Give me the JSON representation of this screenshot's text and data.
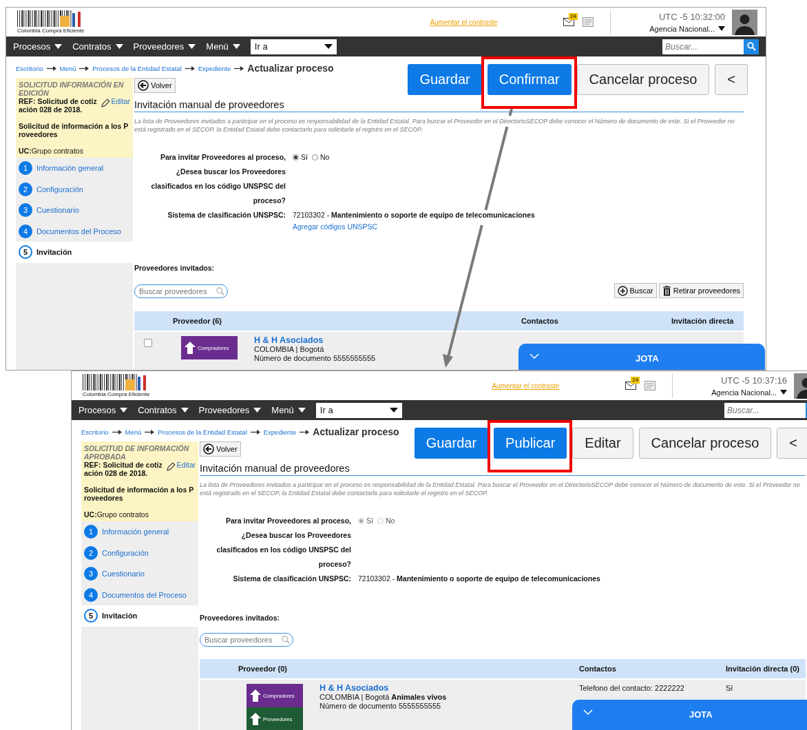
{
  "screens": [
    {
      "header": {
        "logo_text": "Colombia Compra Eficiente",
        "contrast_link": "Aumentar el contraste",
        "mail_count": "24",
        "timezone": "UTC -5",
        "time": "10:32:00",
        "agency": "Agencia Nacional..."
      },
      "nav": {
        "items": [
          "Procesos",
          "Contratos",
          "Proveedores",
          "Menú"
        ],
        "goto": "Ir a",
        "search_placeholder": "Buscar..."
      },
      "breadcrumb": {
        "links": [
          "Escritorio",
          "Menú",
          "Procesos de la Entidad Estatal",
          "Expediente"
        ],
        "current": "Actualizar proceso"
      },
      "actions": [
        {
          "label": "Guardar",
          "kind": "primary",
          "highlighted": false
        },
        {
          "label": "Confirmar",
          "kind": "primary",
          "highlighted": true
        },
        {
          "label": "Cancelar proceso",
          "kind": "secondary",
          "highlighted": false
        },
        {
          "label": "<",
          "kind": "secondary",
          "highlighted": false
        }
      ],
      "summary": {
        "status": "SOLICITUD INFORMACIÓN EN EDICIÓN",
        "reference": "REF: Solicitud de cotización 028 de 2018.",
        "edit": "Editar",
        "description": "Solicitud de información a los Proveedores",
        "unit_label": "UC:",
        "unit": "Grupo contratos"
      },
      "steps": [
        {
          "number": "1",
          "label": "Información general",
          "selected": false
        },
        {
          "number": "2",
          "label": "Configuración",
          "selected": false
        },
        {
          "number": "3",
          "label": "Cuestionario",
          "selected": false
        },
        {
          "number": "4",
          "label": "Documentos del Proceso",
          "selected": false
        },
        {
          "number": "5",
          "label": "Invitación",
          "selected": true
        }
      ],
      "back": "Volver",
      "section_title": "Invitación manual de proveedores",
      "notice": "La lista de Proveedores invitados a participar en el proceso es responsabilidad de la Entidad Estatal. Para buscar el Proveedor en el DirectorioSECOP debe conocer el Número de documento de este. Si el Proveedor no está registrado en el SECOP, la Entidad Estatal debe contactarlo para solicitarle el registro en el SECOP.",
      "invite_question": "Para invitar Proveedores al proceso, ¿Desea buscar los Proveedores clasificados en los código UNSPSC del proceso?",
      "options": [
        {
          "label": "Sí",
          "selected": true,
          "disabled": false
        },
        {
          "label": "No",
          "selected": false,
          "disabled": false
        }
      ],
      "unspsc": {
        "label": "Sistema de clasificación UNSPSC:",
        "value": "72103302 - **Mantenimiento o soporte de equipo de telecomunicaciones**",
        "add_link": "Agregar códigos UNSPSC"
      },
      "invited_label": "Proveedores invitados:",
      "supplier_search_placeholder": "Buscar proveedores",
      "tools": [
        {
          "label": "Buscar",
          "kind": "add"
        },
        {
          "label": "Retirar proveedores",
          "kind": "remove"
        }
      ],
      "table": {
        "columns": [
          "Proveedor (6)",
          "Contactos",
          "Invitación directa"
        ],
        "rows": [
          {
            "checked": false,
            "logo": [
              {
                "label": "Compradores",
                "color": "#6b2c8f"
              }
            ],
            "name": "H & H Asociados",
            "location": "COLOMBIA | Bogotá",
            "document": "Número de documento 5555555555"
          }
        ]
      },
      "chat": {
        "title": "JOTA"
      }
    },
    {
      "header": {
        "logo_text": "Colombia Compra Eficiente",
        "contrast_link": "Aumentar el contraste",
        "mail_count": "24",
        "timezone": "UTC -5",
        "time": "10:37:16",
        "agency": "Agencia Nacional..."
      },
      "nav": {
        "items": [
          "Procesos",
          "Contratos",
          "Proveedores",
          "Menú"
        ],
        "goto": "Ir a",
        "search_placeholder": "Buscar..."
      },
      "breadcrumb": {
        "links": [
          "Escritorio",
          "Menú",
          "Procesos de la Entidad Estatal",
          "Expediente"
        ],
        "current": "Actualizar proceso"
      },
      "actions": [
        {
          "label": "Guardar",
          "kind": "primary",
          "highlighted": false
        },
        {
          "label": "Publicar",
          "kind": "primary",
          "highlighted": true
        },
        {
          "label": "Editar",
          "kind": "secondary",
          "highlighted": false
        },
        {
          "label": "Cancelar proceso",
          "kind": "secondary",
          "highlighted": false
        },
        {
          "label": "<",
          "kind": "secondary",
          "highlighted": false
        }
      ],
      "summary": {
        "status": "SOLICITUD DE INFORMACIÓN APROBADA",
        "reference": "REF: Solicitud de cotización 028 de 2018.",
        "edit": "Editar",
        "description": "Solicitud de información a los Proveedores",
        "unit_label": "UC:",
        "unit": "Grupo contratos"
      },
      "steps": [
        {
          "number": "1",
          "label": "Información general",
          "selected": false
        },
        {
          "number": "2",
          "label": "Configuración",
          "selected": false
        },
        {
          "number": "3",
          "label": "Cuestionario",
          "selected": false
        },
        {
          "number": "4",
          "label": "Documentos del Proceso",
          "selected": false
        },
        {
          "number": "5",
          "label": "Invitación",
          "selected": true
        }
      ],
      "back": "Volver",
      "section_title": "Invitación manual de proveedores",
      "notice": "La lista de Proveedores invitados a participar en el proceso es responsabilidad de la Entidad Estatal. Para buscar el Proveedor en el DirectorioSECOP debe conocer el Número de documento de este. Si el Proveedor no está registrado en el SECOP, la Entidad Estatal debe contactarlo para solicitarle el registro en el SECOP.",
      "invite_question": "Para invitar Proveedores al proceso, ¿Desea buscar los Proveedores clasificados en los código UNSPSC del proceso?",
      "options": [
        {
          "label": "Sí",
          "selected": true,
          "disabled": true
        },
        {
          "label": "No",
          "selected": false,
          "disabled": true
        }
      ],
      "unspsc": {
        "label": "Sistema de clasificación UNSPSC:",
        "value": "72103302 - **Mantenimiento o soporte de equipo de telecomunicaciones**"
      },
      "invited_label": "Proveedores invitados:",
      "supplier_search_placeholder": "Buscar proveedores",
      "table": {
        "columns": [
          "Proveedor (0)",
          "Contactos",
          "Invitación directa (0)"
        ],
        "rows": [
          {
            "logo": [
              {
                "label": "Compradores",
                "color": "#6b2c8f"
              },
              {
                "label": "Proveedores",
                "color": "#1f5b35"
              }
            ],
            "name": "H & H Asociados",
            "location": "COLOMBIA | Bogotá  **Animales vivos**",
            "document": "Número de documento 5555555555",
            "contact": "Telefono del contacto: 2222222",
            "invitation": "Sí"
          }
        ]
      },
      "chat": {
        "title": "JOTA"
      }
    }
  ]
}
